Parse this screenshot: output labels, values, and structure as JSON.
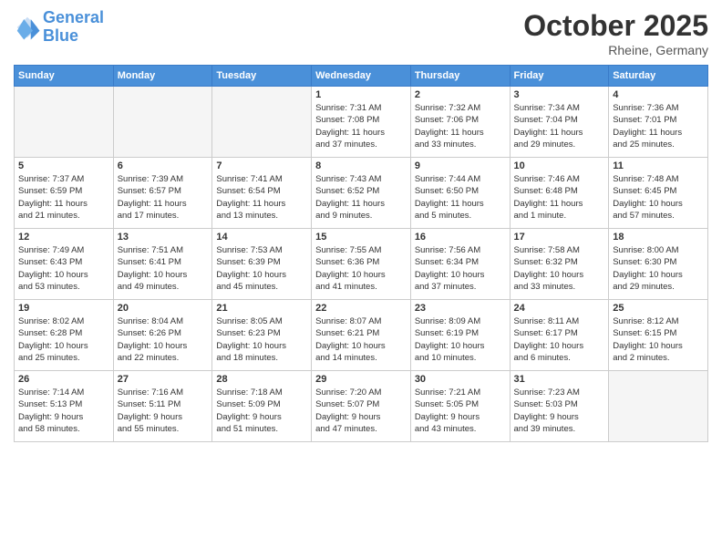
{
  "header": {
    "logo_line1": "General",
    "logo_line2": "Blue",
    "month": "October 2025",
    "location": "Rheine, Germany"
  },
  "weekdays": [
    "Sunday",
    "Monday",
    "Tuesday",
    "Wednesday",
    "Thursday",
    "Friday",
    "Saturday"
  ],
  "weeks": [
    [
      {
        "day": "",
        "detail": "",
        "empty": true
      },
      {
        "day": "",
        "detail": "",
        "empty": true
      },
      {
        "day": "",
        "detail": "",
        "empty": true
      },
      {
        "day": "1",
        "detail": "Sunrise: 7:31 AM\nSunset: 7:08 PM\nDaylight: 11 hours\nand 37 minutes."
      },
      {
        "day": "2",
        "detail": "Sunrise: 7:32 AM\nSunset: 7:06 PM\nDaylight: 11 hours\nand 33 minutes."
      },
      {
        "day": "3",
        "detail": "Sunrise: 7:34 AM\nSunset: 7:04 PM\nDaylight: 11 hours\nand 29 minutes."
      },
      {
        "day": "4",
        "detail": "Sunrise: 7:36 AM\nSunset: 7:01 PM\nDaylight: 11 hours\nand 25 minutes."
      }
    ],
    [
      {
        "day": "5",
        "detail": "Sunrise: 7:37 AM\nSunset: 6:59 PM\nDaylight: 11 hours\nand 21 minutes."
      },
      {
        "day": "6",
        "detail": "Sunrise: 7:39 AM\nSunset: 6:57 PM\nDaylight: 11 hours\nand 17 minutes."
      },
      {
        "day": "7",
        "detail": "Sunrise: 7:41 AM\nSunset: 6:54 PM\nDaylight: 11 hours\nand 13 minutes."
      },
      {
        "day": "8",
        "detail": "Sunrise: 7:43 AM\nSunset: 6:52 PM\nDaylight: 11 hours\nand 9 minutes."
      },
      {
        "day": "9",
        "detail": "Sunrise: 7:44 AM\nSunset: 6:50 PM\nDaylight: 11 hours\nand 5 minutes."
      },
      {
        "day": "10",
        "detail": "Sunrise: 7:46 AM\nSunset: 6:48 PM\nDaylight: 11 hours\nand 1 minute."
      },
      {
        "day": "11",
        "detail": "Sunrise: 7:48 AM\nSunset: 6:45 PM\nDaylight: 10 hours\nand 57 minutes."
      }
    ],
    [
      {
        "day": "12",
        "detail": "Sunrise: 7:49 AM\nSunset: 6:43 PM\nDaylight: 10 hours\nand 53 minutes."
      },
      {
        "day": "13",
        "detail": "Sunrise: 7:51 AM\nSunset: 6:41 PM\nDaylight: 10 hours\nand 49 minutes."
      },
      {
        "day": "14",
        "detail": "Sunrise: 7:53 AM\nSunset: 6:39 PM\nDaylight: 10 hours\nand 45 minutes."
      },
      {
        "day": "15",
        "detail": "Sunrise: 7:55 AM\nSunset: 6:36 PM\nDaylight: 10 hours\nand 41 minutes."
      },
      {
        "day": "16",
        "detail": "Sunrise: 7:56 AM\nSunset: 6:34 PM\nDaylight: 10 hours\nand 37 minutes."
      },
      {
        "day": "17",
        "detail": "Sunrise: 7:58 AM\nSunset: 6:32 PM\nDaylight: 10 hours\nand 33 minutes."
      },
      {
        "day": "18",
        "detail": "Sunrise: 8:00 AM\nSunset: 6:30 PM\nDaylight: 10 hours\nand 29 minutes."
      }
    ],
    [
      {
        "day": "19",
        "detail": "Sunrise: 8:02 AM\nSunset: 6:28 PM\nDaylight: 10 hours\nand 25 minutes."
      },
      {
        "day": "20",
        "detail": "Sunrise: 8:04 AM\nSunset: 6:26 PM\nDaylight: 10 hours\nand 22 minutes."
      },
      {
        "day": "21",
        "detail": "Sunrise: 8:05 AM\nSunset: 6:23 PM\nDaylight: 10 hours\nand 18 minutes."
      },
      {
        "day": "22",
        "detail": "Sunrise: 8:07 AM\nSunset: 6:21 PM\nDaylight: 10 hours\nand 14 minutes."
      },
      {
        "day": "23",
        "detail": "Sunrise: 8:09 AM\nSunset: 6:19 PM\nDaylight: 10 hours\nand 10 minutes."
      },
      {
        "day": "24",
        "detail": "Sunrise: 8:11 AM\nSunset: 6:17 PM\nDaylight: 10 hours\nand 6 minutes."
      },
      {
        "day": "25",
        "detail": "Sunrise: 8:12 AM\nSunset: 6:15 PM\nDaylight: 10 hours\nand 2 minutes."
      }
    ],
    [
      {
        "day": "26",
        "detail": "Sunrise: 7:14 AM\nSunset: 5:13 PM\nDaylight: 9 hours\nand 58 minutes."
      },
      {
        "day": "27",
        "detail": "Sunrise: 7:16 AM\nSunset: 5:11 PM\nDaylight: 9 hours\nand 55 minutes."
      },
      {
        "day": "28",
        "detail": "Sunrise: 7:18 AM\nSunset: 5:09 PM\nDaylight: 9 hours\nand 51 minutes."
      },
      {
        "day": "29",
        "detail": "Sunrise: 7:20 AM\nSunset: 5:07 PM\nDaylight: 9 hours\nand 47 minutes."
      },
      {
        "day": "30",
        "detail": "Sunrise: 7:21 AM\nSunset: 5:05 PM\nDaylight: 9 hours\nand 43 minutes."
      },
      {
        "day": "31",
        "detail": "Sunrise: 7:23 AM\nSunset: 5:03 PM\nDaylight: 9 hours\nand 39 minutes."
      },
      {
        "day": "",
        "detail": "",
        "empty": true
      }
    ]
  ]
}
